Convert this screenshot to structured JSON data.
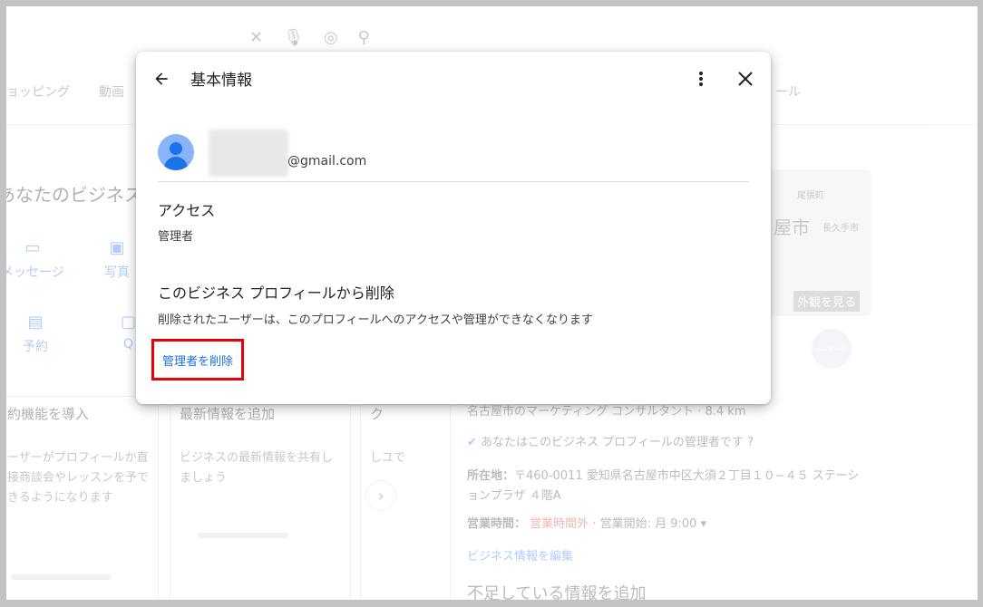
{
  "background": {
    "tabs": [
      "ョッピング",
      "動画"
    ],
    "tab_right": "ール",
    "business_title": "あなたのビジネス",
    "actions": [
      {
        "label": "メッセージ",
        "icon": "message-icon"
      },
      {
        "label": "写真",
        "icon": "photo-icon"
      },
      {
        "label": "予約",
        "icon": "calendar-icon"
      },
      {
        "label": "Q",
        "icon": "qa-icon"
      }
    ],
    "cards": [
      {
        "title": "約機能を導入",
        "desc": "ーザーがプロフィールか直接商談会やレッスンを予できるようになります"
      },
      {
        "title": "最新情報を追加",
        "desc": "ビジネスの最新情報を共有しましょう"
      },
      {
        "title": "ク",
        "desc": "しユで"
      }
    ],
    "map": {
      "city": "屋市",
      "exterior_label": "外観を見る",
      "label_top": "尾張町",
      "label_mid": "長久手市"
    },
    "logo_text": "ALTENAS",
    "right_panel": {
      "category": "名古屋市のマーケティング コンサルタント · 8.4 km",
      "owner_note": "あなたはこのビジネス プロフィールの管理者です",
      "address_label": "所在地：",
      "address": "〒460-0011 愛知県名古屋市中区大須２丁目１０−４５ ステーションプラザ ４階A",
      "hours_label": "営業時間：",
      "hours_status": "営業時間外",
      "hours_rest": "· 営業開始: 月 9:00 ▾",
      "edit_link": "ビジネス情報を編集",
      "missing": "不足している情報を追加"
    }
  },
  "dialog": {
    "title": "基本情報",
    "email_domain": "@gmail.com",
    "access": {
      "title": "アクセス",
      "role": "管理者"
    },
    "remove_section": {
      "title": "このビジネス プロフィールから削除",
      "description": "削除されたユーザーは、このプロフィールへのアクセスや管理ができなくなります",
      "action_label": "管理者を削除"
    }
  },
  "colors": {
    "accent": "#1a73e8",
    "highlight_border": "#e8000b",
    "avatar_bg": "#8ab4f8"
  }
}
